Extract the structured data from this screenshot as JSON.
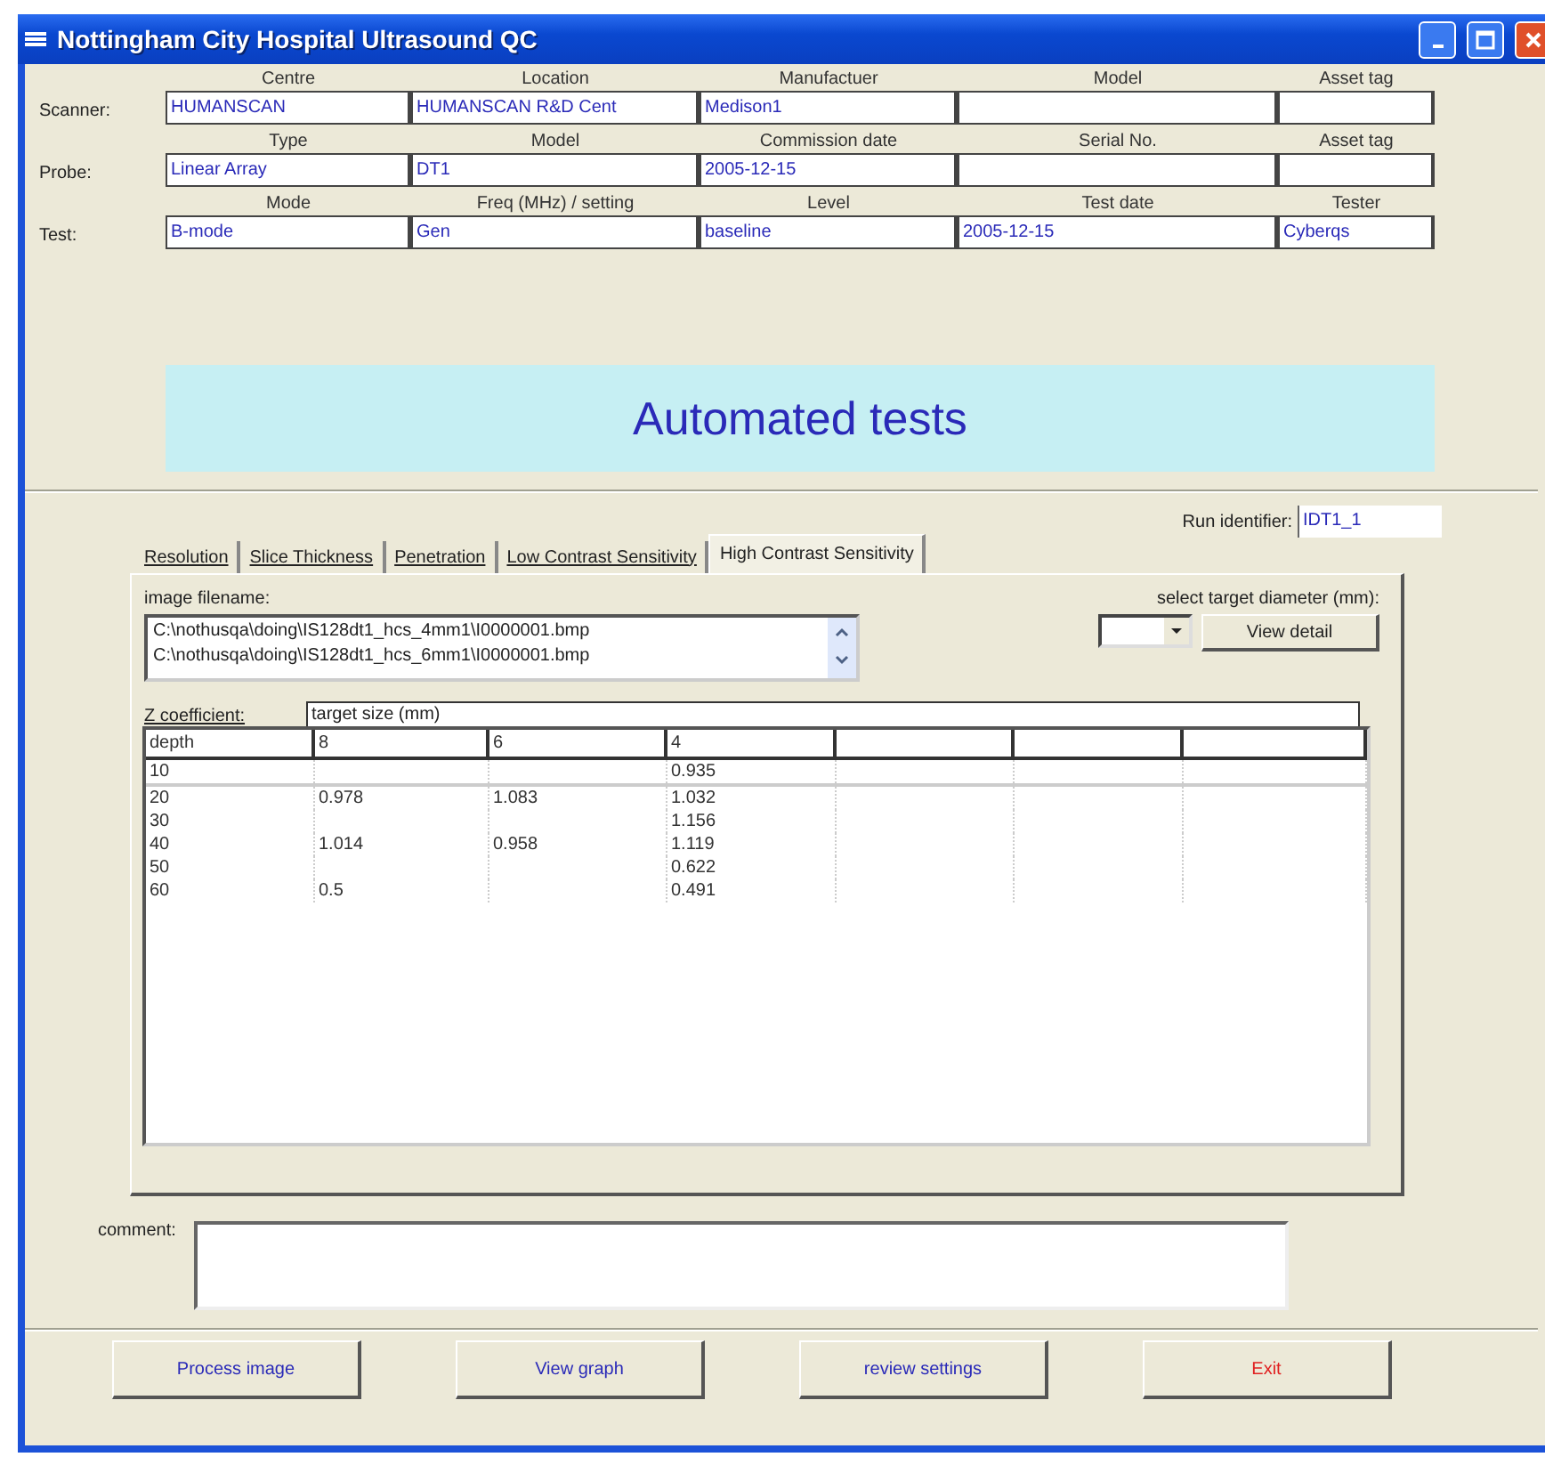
{
  "window": {
    "title": "Nottingham City Hospital Ultrasound QC"
  },
  "info_rows": [
    {
      "label": "Scanner:",
      "fields": [
        {
          "header": "Centre",
          "value": "HUMANSCAN"
        },
        {
          "header": "Location",
          "value": "HUMANSCAN R&D Cent"
        },
        {
          "header": "Manufactuer",
          "value": "Medison1"
        },
        {
          "header": "Model"
        },
        {
          "header": "Asset tag"
        }
      ]
    },
    {
      "label": "Probe:",
      "fields": [
        {
          "header": "Type",
          "value": "Linear Array"
        },
        {
          "header": "Model",
          "value": "DT1"
        },
        {
          "header": "Commission date",
          "value": "2005-12-15"
        },
        {
          "header": "Serial No."
        },
        {
          "header": "Asset tag"
        }
      ]
    },
    {
      "label": "Test:",
      "fields": [
        {
          "header": "Mode",
          "value": "B-mode"
        },
        {
          "header": "Freq (MHz) / setting",
          "value": "Gen"
        },
        {
          "header": "Level",
          "value": "baseline"
        },
        {
          "header": "Test date",
          "value": "2005-12-15"
        },
        {
          "header": "Tester",
          "value": "Cyberqs"
        }
      ]
    }
  ],
  "banner": "Automated tests",
  "run_identifier": {
    "label": "Run identifier:",
    "value": "IDT1_1"
  },
  "tabs": [
    {
      "label": "Resolution",
      "selected": false
    },
    {
      "label": "Slice Thickness",
      "selected": false
    },
    {
      "label": "Penetration",
      "selected": false
    },
    {
      "label": "Low Contrast Sensitivity",
      "selected": false
    },
    {
      "label": "High Contrast Sensitivity",
      "selected": true
    }
  ],
  "image_filename": {
    "label": "image filename:",
    "items": [
      "C:\\nothusqa\\doing\\IS128dt1_hcs_4mm1\\I0000001.bmp",
      "C:\\nothusqa\\doing\\IS128dt1_hcs_6mm1\\I0000001.bmp"
    ]
  },
  "target_diameter": {
    "label": "select target diameter (mm):",
    "button": "View detail"
  },
  "z_coefficient": {
    "label": "Z coefficient:",
    "group_header": "target size (mm)",
    "columns": [
      "depth",
      "8",
      "6",
      "4"
    ],
    "rows": [
      [
        "10",
        null,
        null,
        "0.935"
      ],
      [
        "20",
        "0.978",
        "1.083",
        "1.032"
      ],
      [
        "30",
        null,
        null,
        "1.156"
      ],
      [
        "40",
        "1.014",
        "0.958",
        "1.119"
      ],
      [
        "50",
        null,
        null,
        "0.622"
      ],
      [
        "60",
        "0.5",
        null,
        "0.491"
      ]
    ]
  },
  "comment": {
    "label": "comment:"
  },
  "buttons": [
    {
      "label": "Process image",
      "color": "#2a2ab8"
    },
    {
      "label": "View graph",
      "color": "#2a2ab8"
    },
    {
      "label": "review settings",
      "color": "#2a2ab8"
    },
    {
      "label": "Exit",
      "color": "#e02020"
    }
  ]
}
